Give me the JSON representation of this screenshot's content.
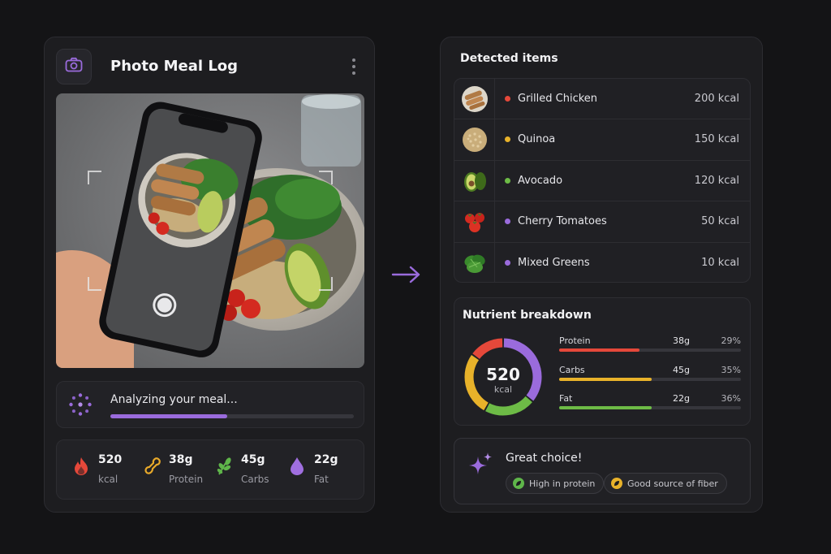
{
  "left_panel": {
    "title": "Photo Meal Log",
    "analyzing": {
      "label": "Analyzing your meal...",
      "progress_percent": 48
    },
    "stats": [
      {
        "value": "520",
        "unit": "kcal",
        "icon": "flame-icon",
        "color": "#e5483a"
      },
      {
        "value": "38g",
        "unit": "Protein",
        "icon": "protein-icon",
        "color": "#e8a92a"
      },
      {
        "value": "45g",
        "unit": "Carbs",
        "icon": "leaf-icon",
        "color": "#5fb64a"
      },
      {
        "value": "22g",
        "unit": "Fat",
        "icon": "droplet-icon",
        "color": "#a06fe0"
      }
    ]
  },
  "right_panel": {
    "detected_title": "Detected items",
    "items": [
      {
        "name": "Grilled Chicken",
        "kcal": "200 kcal",
        "dot": "#e5483a",
        "thumb": "chicken-thumb"
      },
      {
        "name": "Quinoa",
        "kcal": "150 kcal",
        "dot": "#e8b22a",
        "thumb": "quinoa-thumb"
      },
      {
        "name": "Avocado",
        "kcal": "120 kcal",
        "dot": "#6dbb46",
        "thumb": "avocado-thumb"
      },
      {
        "name": "Cherry Tomatoes",
        "kcal": "50 kcal",
        "dot": "#9a6bdc",
        "thumb": "tomatoes-thumb"
      },
      {
        "name": "Mixed Greens",
        "kcal": "10 kcal",
        "dot": "#9a6bdc",
        "thumb": "greens-thumb"
      }
    ],
    "nutrient": {
      "title": "Nutrient breakdown",
      "total": "520",
      "total_unit": "kcal",
      "rows": [
        {
          "name": "Protein",
          "grams": "38g",
          "percent": "29%",
          "fraction": 0.44,
          "color": "#e5483a"
        },
        {
          "name": "Carbs",
          "grams": "45g",
          "percent": "35%",
          "fraction": 0.51,
          "color": "#e8b22a"
        },
        {
          "name": "Fat",
          "grams": "22g",
          "percent": "36%",
          "fraction": 0.51,
          "color": "#6dbb46"
        }
      ],
      "donut_segments": [
        {
          "name": "purple",
          "fraction": 0.36,
          "color": "#9a6bdc"
        },
        {
          "name": "green",
          "fraction": 0.22,
          "color": "#6dbb46"
        },
        {
          "name": "yellow",
          "fraction": 0.27,
          "color": "#e8b22a"
        },
        {
          "name": "red",
          "fraction": 0.15,
          "color": "#e5483a"
        }
      ]
    },
    "choice": {
      "title": "Great choice!",
      "tags": [
        "High in protein",
        "Good source of fiber"
      ]
    }
  },
  "colors": {
    "accent": "#9a6bdc",
    "panel": "#1d1d20",
    "background": "#141416"
  }
}
